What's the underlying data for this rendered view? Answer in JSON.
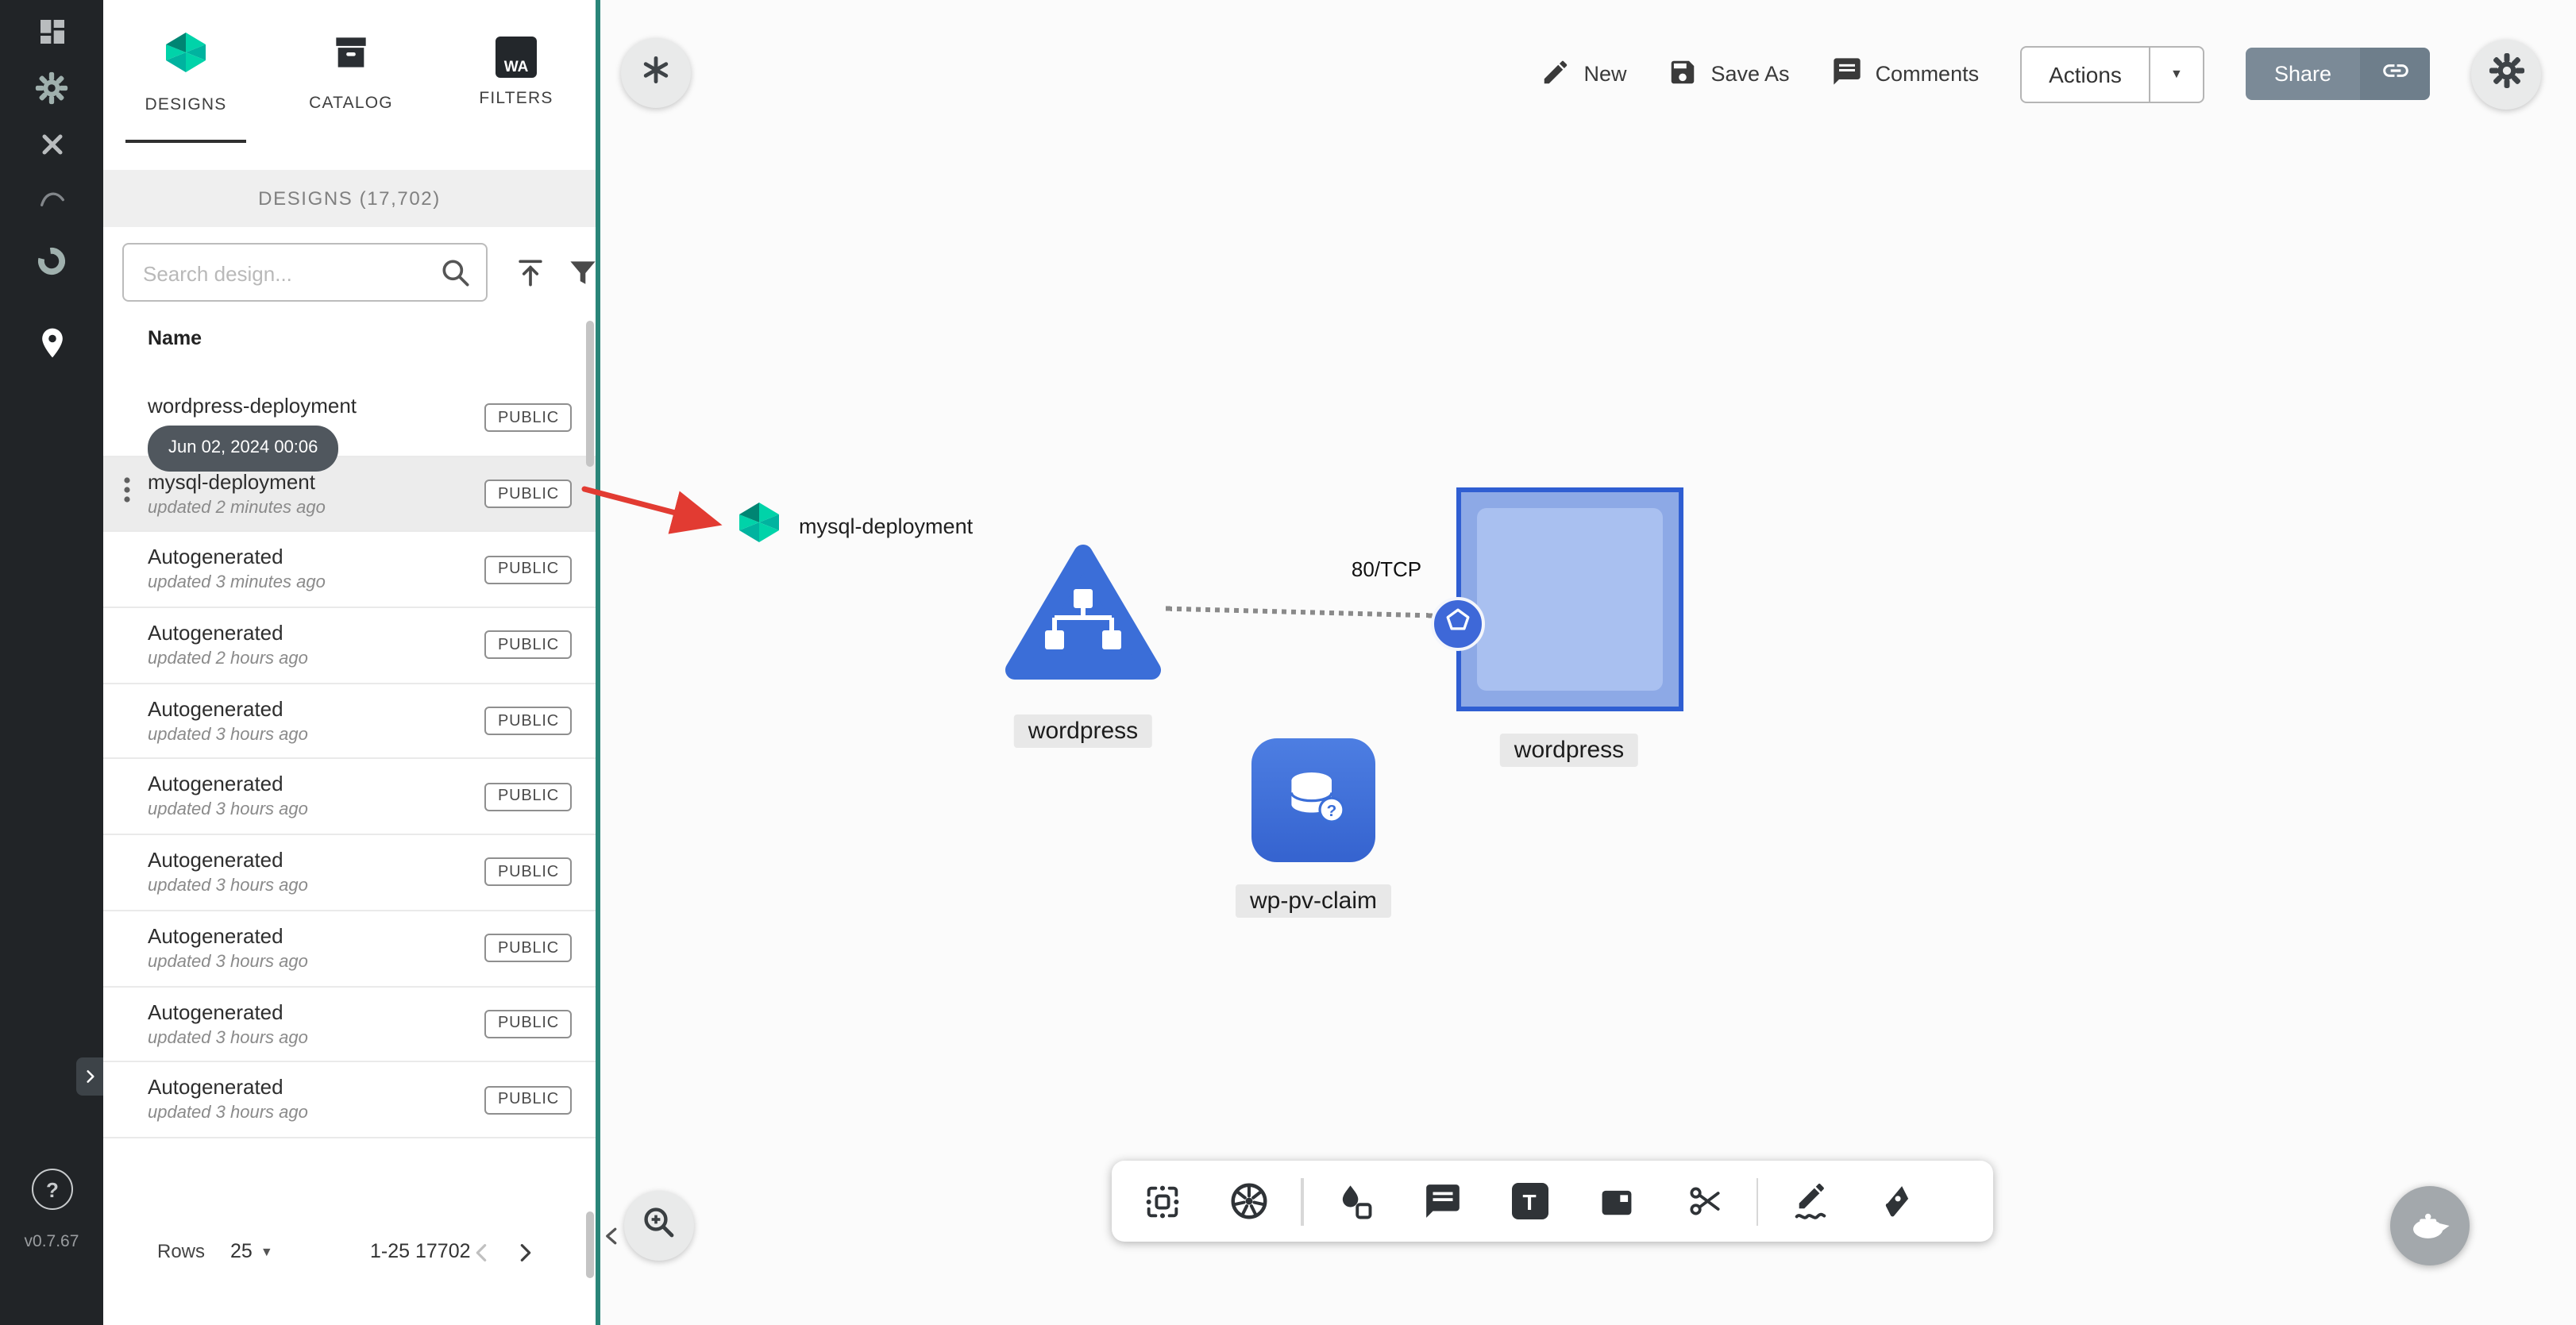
{
  "app": {
    "version": "v0.7.67"
  },
  "sidebar": {
    "icons": [
      "dashboard",
      "settings",
      "toolbox",
      "lifecycle",
      "performance",
      "meshmap"
    ],
    "help_label": "?"
  },
  "panel": {
    "tabs": [
      {
        "label": "DESIGNS"
      },
      {
        "label": "CATALOG"
      },
      {
        "label": "FILTERS"
      }
    ],
    "filters_icon_text": "WA",
    "header": "DESIGNS (17,702)",
    "search": {
      "placeholder": "Search design..."
    },
    "table": {
      "name_header": "Name"
    },
    "tooltip": "Jun 02, 2024 00:06",
    "rows": [
      {
        "name": "wordpress-deployment",
        "updated": "",
        "badge": "PUBLIC"
      },
      {
        "name": "mysql-deployment",
        "updated": "updated 2 minutes ago",
        "badge": "PUBLIC",
        "hover": true
      },
      {
        "name": "Autogenerated",
        "updated": "updated 3 minutes ago",
        "badge": "PUBLIC"
      },
      {
        "name": "Autogenerated",
        "updated": "updated 2 hours ago",
        "badge": "PUBLIC"
      },
      {
        "name": "Autogenerated",
        "updated": "updated 3 hours ago",
        "badge": "PUBLIC"
      },
      {
        "name": "Autogenerated",
        "updated": "updated 3 hours ago",
        "badge": "PUBLIC"
      },
      {
        "name": "Autogenerated",
        "updated": "updated 3 hours ago",
        "badge": "PUBLIC"
      },
      {
        "name": "Autogenerated",
        "updated": "updated 3 hours ago",
        "badge": "PUBLIC"
      },
      {
        "name": "Autogenerated",
        "updated": "updated 3 hours ago",
        "badge": "PUBLIC"
      },
      {
        "name": "Autogenerated",
        "updated": "updated 3 hours ago",
        "badge": "PUBLIC"
      }
    ],
    "footer": {
      "rows_label": "Rows",
      "rows_per_page": "25",
      "range": "1-25 17702"
    }
  },
  "canvas": {
    "topbar": {
      "new": "New",
      "save_as": "Save As",
      "comments": "Comments",
      "actions": "Actions",
      "share": "Share"
    },
    "nodes": {
      "mysql_label": "mysql-deployment",
      "deployment_label": "wordpress",
      "service_label": "wordpress",
      "pvc_label": "wp-pv-claim"
    },
    "edge": {
      "label": "80/TCP"
    },
    "text_tool_letter": "T"
  },
  "colors": {
    "accent_teal": "#00B39F",
    "divider_teal": "#2a8579",
    "node_blue": "#3b6ed8",
    "selection_blue": "#2f5ed2",
    "arrow_red": "#e23b32"
  }
}
